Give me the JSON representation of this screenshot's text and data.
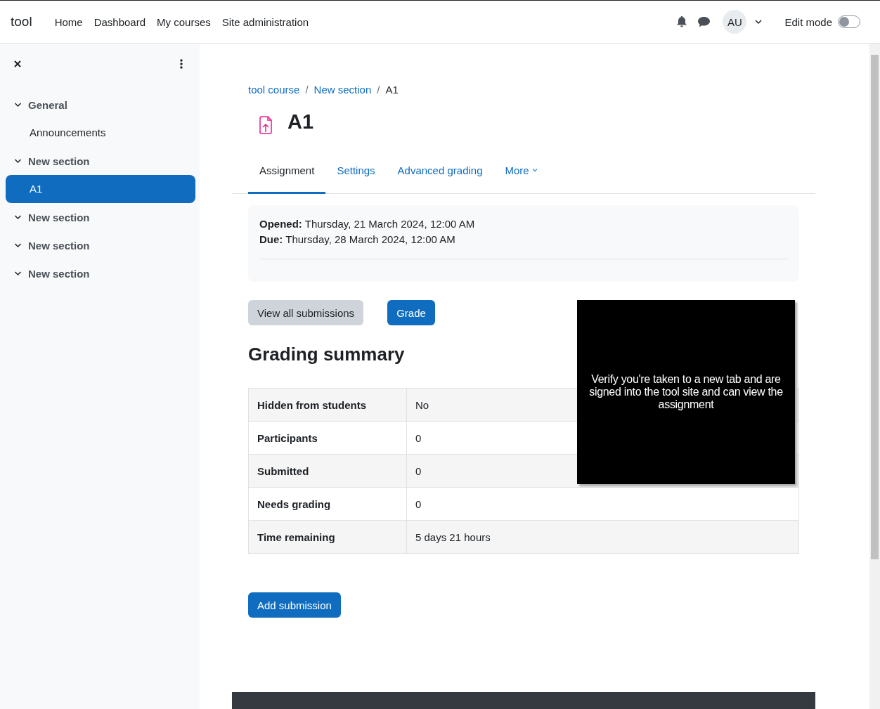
{
  "navbar": {
    "brand": "tool",
    "links": [
      {
        "label": "Home"
      },
      {
        "label": "Dashboard"
      },
      {
        "label": "My courses"
      },
      {
        "label": "Site administration"
      }
    ],
    "avatar": "AU",
    "edit_mode": {
      "label": "Edit mode",
      "on": false
    }
  },
  "course_index": {
    "sections": [
      {
        "title": "General",
        "expanded": true,
        "children": [
          {
            "label": "Announcements",
            "selected": false
          }
        ]
      },
      {
        "title": "New section",
        "expanded": true,
        "children": [
          {
            "label": "A1",
            "selected": true
          }
        ]
      },
      {
        "title": "New section",
        "expanded": true
      },
      {
        "title": "New section",
        "expanded": true
      },
      {
        "title": "New section",
        "expanded": true
      }
    ]
  },
  "breadcrumb": [
    {
      "label": "tool course",
      "kind": "link"
    },
    {
      "label": "New section",
      "kind": "link",
      "separator": "/"
    },
    {
      "label": "A1",
      "kind": "current",
      "separator": "/"
    }
  ],
  "page_title": "A1",
  "tabs": [
    {
      "label": "Assignment",
      "selected": true,
      "kind": "link"
    },
    {
      "label": "Settings",
      "selected": false,
      "kind": "link"
    },
    {
      "label": "Advanced grading",
      "selected": false,
      "kind": "link"
    },
    {
      "label": "More",
      "selected": false,
      "kind": "dropdown"
    }
  ],
  "dates": [
    "**Opened:** Thursday, 21 March 2024, 12:00 AM",
    "**Due:** Thursday, 28 March 2024, 12:00 AM"
  ],
  "actions": [
    {
      "label": "View all submissions",
      "kind": "secondary"
    },
    {
      "label": "Grade",
      "kind": "primary"
    }
  ],
  "grading_summary": {
    "title": "Grading summary",
    "rows": [
      {
        "label": "Hidden from students",
        "value": "No"
      },
      {
        "label": "Participants",
        "value": "0"
      },
      {
        "label": "Submitted",
        "value": "0"
      },
      {
        "label": "Needs grading",
        "value": "0"
      },
      {
        "label": "Time remaining",
        "value": "5 days 21 hours"
      }
    ]
  },
  "add_submission": "Add submission",
  "overlay": {
    "text": "Verify you're taken to a new tab and are signed into the tool site and can view the assignment"
  }
}
